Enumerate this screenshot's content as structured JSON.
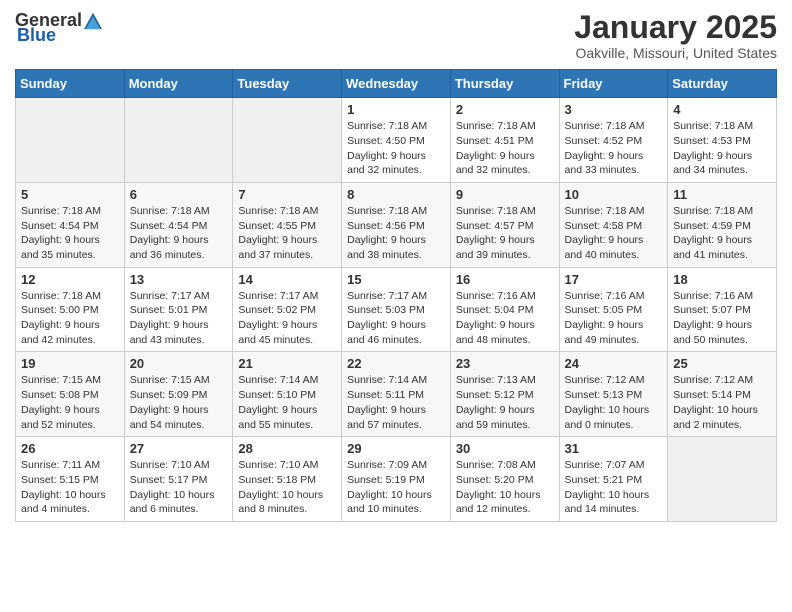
{
  "logo": {
    "general": "General",
    "blue": "Blue"
  },
  "header": {
    "month": "January 2025",
    "location": "Oakville, Missouri, United States"
  },
  "weekdays": [
    "Sunday",
    "Monday",
    "Tuesday",
    "Wednesday",
    "Thursday",
    "Friday",
    "Saturday"
  ],
  "weeks": [
    [
      {
        "day": "",
        "info": ""
      },
      {
        "day": "",
        "info": ""
      },
      {
        "day": "",
        "info": ""
      },
      {
        "day": "1",
        "info": "Sunrise: 7:18 AM\nSunset: 4:50 PM\nDaylight: 9 hours and 32 minutes."
      },
      {
        "day": "2",
        "info": "Sunrise: 7:18 AM\nSunset: 4:51 PM\nDaylight: 9 hours and 32 minutes."
      },
      {
        "day": "3",
        "info": "Sunrise: 7:18 AM\nSunset: 4:52 PM\nDaylight: 9 hours and 33 minutes."
      },
      {
        "day": "4",
        "info": "Sunrise: 7:18 AM\nSunset: 4:53 PM\nDaylight: 9 hours and 34 minutes."
      }
    ],
    [
      {
        "day": "5",
        "info": "Sunrise: 7:18 AM\nSunset: 4:54 PM\nDaylight: 9 hours and 35 minutes."
      },
      {
        "day": "6",
        "info": "Sunrise: 7:18 AM\nSunset: 4:54 PM\nDaylight: 9 hours and 36 minutes."
      },
      {
        "day": "7",
        "info": "Sunrise: 7:18 AM\nSunset: 4:55 PM\nDaylight: 9 hours and 37 minutes."
      },
      {
        "day": "8",
        "info": "Sunrise: 7:18 AM\nSunset: 4:56 PM\nDaylight: 9 hours and 38 minutes."
      },
      {
        "day": "9",
        "info": "Sunrise: 7:18 AM\nSunset: 4:57 PM\nDaylight: 9 hours and 39 minutes."
      },
      {
        "day": "10",
        "info": "Sunrise: 7:18 AM\nSunset: 4:58 PM\nDaylight: 9 hours and 40 minutes."
      },
      {
        "day": "11",
        "info": "Sunrise: 7:18 AM\nSunset: 4:59 PM\nDaylight: 9 hours and 41 minutes."
      }
    ],
    [
      {
        "day": "12",
        "info": "Sunrise: 7:18 AM\nSunset: 5:00 PM\nDaylight: 9 hours and 42 minutes."
      },
      {
        "day": "13",
        "info": "Sunrise: 7:17 AM\nSunset: 5:01 PM\nDaylight: 9 hours and 43 minutes."
      },
      {
        "day": "14",
        "info": "Sunrise: 7:17 AM\nSunset: 5:02 PM\nDaylight: 9 hours and 45 minutes."
      },
      {
        "day": "15",
        "info": "Sunrise: 7:17 AM\nSunset: 5:03 PM\nDaylight: 9 hours and 46 minutes."
      },
      {
        "day": "16",
        "info": "Sunrise: 7:16 AM\nSunset: 5:04 PM\nDaylight: 9 hours and 48 minutes."
      },
      {
        "day": "17",
        "info": "Sunrise: 7:16 AM\nSunset: 5:05 PM\nDaylight: 9 hours and 49 minutes."
      },
      {
        "day": "18",
        "info": "Sunrise: 7:16 AM\nSunset: 5:07 PM\nDaylight: 9 hours and 50 minutes."
      }
    ],
    [
      {
        "day": "19",
        "info": "Sunrise: 7:15 AM\nSunset: 5:08 PM\nDaylight: 9 hours and 52 minutes."
      },
      {
        "day": "20",
        "info": "Sunrise: 7:15 AM\nSunset: 5:09 PM\nDaylight: 9 hours and 54 minutes."
      },
      {
        "day": "21",
        "info": "Sunrise: 7:14 AM\nSunset: 5:10 PM\nDaylight: 9 hours and 55 minutes."
      },
      {
        "day": "22",
        "info": "Sunrise: 7:14 AM\nSunset: 5:11 PM\nDaylight: 9 hours and 57 minutes."
      },
      {
        "day": "23",
        "info": "Sunrise: 7:13 AM\nSunset: 5:12 PM\nDaylight: 9 hours and 59 minutes."
      },
      {
        "day": "24",
        "info": "Sunrise: 7:12 AM\nSunset: 5:13 PM\nDaylight: 10 hours and 0 minutes."
      },
      {
        "day": "25",
        "info": "Sunrise: 7:12 AM\nSunset: 5:14 PM\nDaylight: 10 hours and 2 minutes."
      }
    ],
    [
      {
        "day": "26",
        "info": "Sunrise: 7:11 AM\nSunset: 5:15 PM\nDaylight: 10 hours and 4 minutes."
      },
      {
        "day": "27",
        "info": "Sunrise: 7:10 AM\nSunset: 5:17 PM\nDaylight: 10 hours and 6 minutes."
      },
      {
        "day": "28",
        "info": "Sunrise: 7:10 AM\nSunset: 5:18 PM\nDaylight: 10 hours and 8 minutes."
      },
      {
        "day": "29",
        "info": "Sunrise: 7:09 AM\nSunset: 5:19 PM\nDaylight: 10 hours and 10 minutes."
      },
      {
        "day": "30",
        "info": "Sunrise: 7:08 AM\nSunset: 5:20 PM\nDaylight: 10 hours and 12 minutes."
      },
      {
        "day": "31",
        "info": "Sunrise: 7:07 AM\nSunset: 5:21 PM\nDaylight: 10 hours and 14 minutes."
      },
      {
        "day": "",
        "info": ""
      }
    ]
  ]
}
